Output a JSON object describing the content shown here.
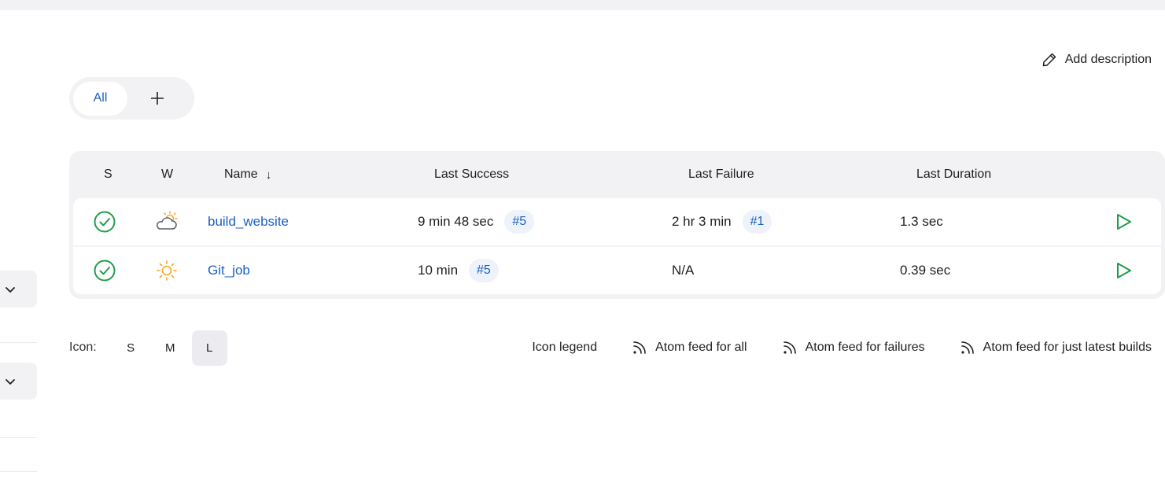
{
  "actions": {
    "add_description": "Add description"
  },
  "tabs": {
    "all": "All",
    "add": "+"
  },
  "table": {
    "headers": {
      "status": "S",
      "weather": "W",
      "name": "Name",
      "name_sort": "↓",
      "last_success": "Last Success",
      "last_failure": "Last Failure",
      "last_duration": "Last Duration"
    },
    "rows": [
      {
        "status_icon": "success-check-icon",
        "weather_icon": "partly-cloudy-icon",
        "name": "build_website",
        "last_success": "9 min 48 sec",
        "last_success_build": "#5",
        "last_failure": "2 hr 3 min",
        "last_failure_build": "#1",
        "last_duration": "1.3 sec"
      },
      {
        "status_icon": "success-check-icon",
        "weather_icon": "sunny-icon",
        "name": "Git_job",
        "last_success": "10 min",
        "last_success_build": "#5",
        "last_failure": "N/A",
        "last_failure_build": "",
        "last_duration": "0.39 sec"
      }
    ]
  },
  "icon_size": {
    "label": "Icon:",
    "options": [
      "S",
      "M",
      "L"
    ],
    "selected": "L"
  },
  "footer": {
    "icon_legend": "Icon legend",
    "atom_all": "Atom feed for all",
    "atom_failures": "Atom feed for failures",
    "atom_latest": "Atom feed for just latest builds"
  },
  "colors": {
    "link": "#1a5fc4",
    "success": "#1e9e4a",
    "sun": "#f5a623",
    "panel": "#f2f2f5"
  }
}
